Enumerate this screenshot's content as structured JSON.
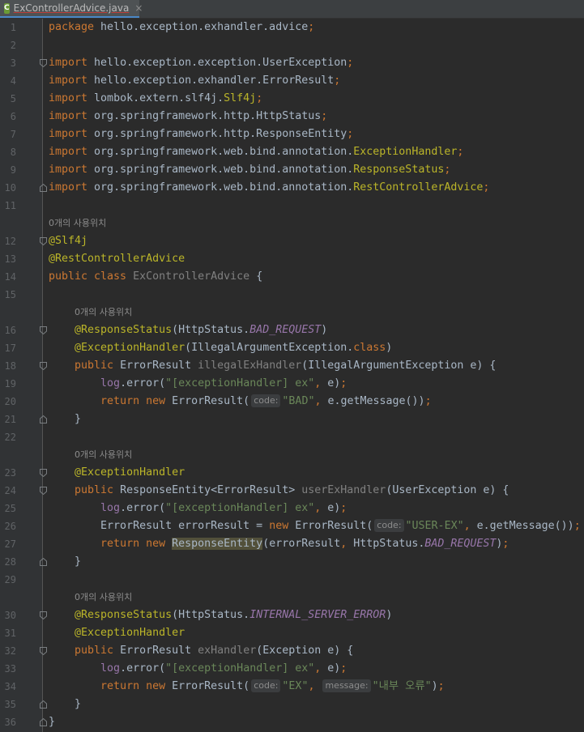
{
  "tab": {
    "icon": "C",
    "filename": "ExControllerAdvice.java",
    "close": "×"
  },
  "usage_hint": "0개의 사용위치",
  "lines": [
    {
      "n": "1",
      "segs": [
        [
          "kw",
          "package "
        ],
        [
          "",
          "hello.exception.exhandler.advice"
        ],
        [
          "kw",
          ";"
        ]
      ]
    },
    {
      "n": "2",
      "segs": []
    },
    {
      "n": "3",
      "segs": [
        [
          "kw",
          "import "
        ],
        [
          "",
          "hello.exception.exception.UserException"
        ],
        [
          "kw",
          ";"
        ]
      ]
    },
    {
      "n": "4",
      "segs": [
        [
          "kw",
          "import "
        ],
        [
          "",
          "hello.exception.exhandler.ErrorResult"
        ],
        [
          "kw",
          ";"
        ]
      ]
    },
    {
      "n": "5",
      "segs": [
        [
          "kw",
          "import "
        ],
        [
          "",
          "lombok.extern.slf4j."
        ],
        [
          "an",
          "Slf4j"
        ],
        [
          "kw",
          ";"
        ]
      ]
    },
    {
      "n": "6",
      "segs": [
        [
          "kw",
          "import "
        ],
        [
          "",
          "org.springframework.http.HttpStatus"
        ],
        [
          "kw",
          ";"
        ]
      ]
    },
    {
      "n": "7",
      "segs": [
        [
          "kw",
          "import "
        ],
        [
          "",
          "org.springframework.http.ResponseEntity"
        ],
        [
          "kw",
          ";"
        ]
      ]
    },
    {
      "n": "8",
      "segs": [
        [
          "kw",
          "import "
        ],
        [
          "",
          "org.springframework.web.bind.annotation."
        ],
        [
          "an",
          "ExceptionHandler"
        ],
        [
          "kw",
          ";"
        ]
      ]
    },
    {
      "n": "9",
      "segs": [
        [
          "kw",
          "import "
        ],
        [
          "",
          "org.springframework.web.bind.annotation."
        ],
        [
          "an",
          "ResponseStatus"
        ],
        [
          "kw",
          ";"
        ]
      ]
    },
    {
      "n": "10",
      "segs": [
        [
          "kw",
          "import "
        ],
        [
          "",
          "org.springframework.web.bind.annotation."
        ],
        [
          "an",
          "RestControllerAdvice"
        ],
        [
          "kw",
          ";"
        ]
      ]
    },
    {
      "n": "11",
      "segs": []
    },
    {
      "n": "",
      "hint": true,
      "indent": 0
    },
    {
      "n": "12",
      "segs": [
        [
          "an",
          "@Slf4j"
        ]
      ]
    },
    {
      "n": "13",
      "segs": [
        [
          "an",
          "@RestControllerAdvice"
        ]
      ]
    },
    {
      "n": "14",
      "segs": [
        [
          "kw",
          "public class "
        ],
        [
          "gm",
          "ExControllerAdvice "
        ],
        [
          "",
          "{"
        ]
      ]
    },
    {
      "n": "15",
      "segs": []
    },
    {
      "n": "",
      "hint": true,
      "indent": 1
    },
    {
      "n": "16",
      "segs": [
        [
          "",
          "    "
        ],
        [
          "an",
          "@ResponseStatus"
        ],
        [
          "",
          "(HttpStatus."
        ],
        [
          "cs",
          "BAD_REQUEST"
        ],
        [
          "",
          ")"
        ]
      ]
    },
    {
      "n": "17",
      "segs": [
        [
          "",
          "    "
        ],
        [
          "an",
          "@ExceptionHandler"
        ],
        [
          "",
          "(IllegalArgumentException."
        ],
        [
          "kw",
          "class"
        ],
        [
          "",
          ")"
        ]
      ]
    },
    {
      "n": "18",
      "segs": [
        [
          "",
          "    "
        ],
        [
          "kw",
          "public "
        ],
        [
          "",
          "ErrorResult "
        ],
        [
          "gm",
          "illegalExHandler"
        ],
        [
          "",
          "(IllegalArgumentException e) {"
        ]
      ]
    },
    {
      "n": "19",
      "segs": [
        [
          "",
          "        "
        ],
        [
          "fd",
          "log"
        ],
        [
          "",
          ".error("
        ],
        [
          "st",
          "\"[exceptionHandler] ex\""
        ],
        [
          "kw",
          ", "
        ],
        [
          "",
          "e)"
        ],
        [
          "kw",
          ";"
        ]
      ]
    },
    {
      "n": "20",
      "segs": [
        [
          "",
          "        "
        ],
        [
          "kw",
          "return new "
        ],
        [
          "",
          "ErrorResult("
        ],
        [
          "ph",
          "code:"
        ],
        [
          "st",
          "\"BAD\""
        ],
        [
          "kw",
          ", "
        ],
        [
          "",
          "e.getMessage())"
        ],
        [
          "kw",
          ";"
        ]
      ]
    },
    {
      "n": "21",
      "segs": [
        [
          "",
          "    }"
        ]
      ]
    },
    {
      "n": "22",
      "segs": []
    },
    {
      "n": "",
      "hint": true,
      "indent": 1
    },
    {
      "n": "23",
      "segs": [
        [
          "",
          "    "
        ],
        [
          "an",
          "@ExceptionHandler"
        ]
      ]
    },
    {
      "n": "24",
      "segs": [
        [
          "",
          "    "
        ],
        [
          "kw",
          "public "
        ],
        [
          "",
          "ResponseEntity<ErrorResult> "
        ],
        [
          "gm",
          "userExHandler"
        ],
        [
          "",
          "(UserException e) {"
        ]
      ]
    },
    {
      "n": "25",
      "segs": [
        [
          "",
          "        "
        ],
        [
          "fd",
          "log"
        ],
        [
          "",
          ".error("
        ],
        [
          "st",
          "\"[exceptionHandler] ex\""
        ],
        [
          "kw",
          ", "
        ],
        [
          "",
          "e)"
        ],
        [
          "kw",
          ";"
        ]
      ]
    },
    {
      "n": "26",
      "segs": [
        [
          "",
          "        ErrorResult errorResult = "
        ],
        [
          "kw",
          "new "
        ],
        [
          "",
          "ErrorResult("
        ],
        [
          "ph",
          "code:"
        ],
        [
          "st",
          "\"USER-EX\""
        ],
        [
          "kw",
          ", "
        ],
        [
          "",
          "e.getMessage())"
        ],
        [
          "kw",
          ";"
        ]
      ]
    },
    {
      "n": "27",
      "segs": [
        [
          "",
          "        "
        ],
        [
          "kw",
          "return new "
        ],
        [
          "hl",
          "ResponseEntity"
        ],
        [
          "",
          "(errorResult"
        ],
        [
          "kw",
          ", "
        ],
        [
          "",
          "HttpStatus."
        ],
        [
          "cs",
          "BAD_REQUEST"
        ],
        [
          "",
          ")"
        ],
        [
          "kw",
          ";"
        ]
      ]
    },
    {
      "n": "28",
      "segs": [
        [
          "",
          "    }"
        ]
      ]
    },
    {
      "n": "29",
      "segs": []
    },
    {
      "n": "",
      "hint": true,
      "indent": 1
    },
    {
      "n": "30",
      "segs": [
        [
          "",
          "    "
        ],
        [
          "an",
          "@ResponseStatus"
        ],
        [
          "",
          "(HttpStatus."
        ],
        [
          "cs",
          "INTERNAL_SERVER_ERROR"
        ],
        [
          "",
          ")"
        ]
      ]
    },
    {
      "n": "31",
      "segs": [
        [
          "",
          "    "
        ],
        [
          "an",
          "@ExceptionHandler"
        ]
      ]
    },
    {
      "n": "32",
      "segs": [
        [
          "",
          "    "
        ],
        [
          "kw",
          "public "
        ],
        [
          "",
          "ErrorResult "
        ],
        [
          "gm",
          "exHandler"
        ],
        [
          "",
          "(Exception e) {"
        ]
      ]
    },
    {
      "n": "33",
      "segs": [
        [
          "",
          "        "
        ],
        [
          "fd",
          "log"
        ],
        [
          "",
          ".error("
        ],
        [
          "st",
          "\"[exceptionHandler] ex\""
        ],
        [
          "kw",
          ", "
        ],
        [
          "",
          "e)"
        ],
        [
          "kw",
          ";"
        ]
      ]
    },
    {
      "n": "34",
      "segs": [
        [
          "",
          "        "
        ],
        [
          "kw",
          "return new "
        ],
        [
          "",
          "ErrorResult("
        ],
        [
          "ph",
          "code:"
        ],
        [
          "st",
          "\"EX\""
        ],
        [
          "kw",
          ", "
        ],
        [
          "ph",
          "message:"
        ],
        [
          "st",
          "\"내부 오류\""
        ],
        [
          "",
          ")"
        ],
        [
          "kw",
          ";"
        ]
      ]
    },
    {
      "n": "35",
      "segs": [
        [
          "",
          "    }"
        ]
      ]
    },
    {
      "n": "36",
      "segs": [
        [
          "",
          "}"
        ]
      ]
    }
  ],
  "folds": {
    "open": [
      "3",
      "12",
      "16",
      "18",
      "23",
      "24",
      "30",
      "32"
    ],
    "close": [
      "10",
      "21",
      "28",
      "35",
      "36"
    ]
  },
  "colors": {
    "background": "#2b2b2b",
    "gutter": "#313335",
    "keyword": "#cc7832",
    "annotation": "#bbb529",
    "string": "#6a8759",
    "constant": "#9876aa"
  }
}
